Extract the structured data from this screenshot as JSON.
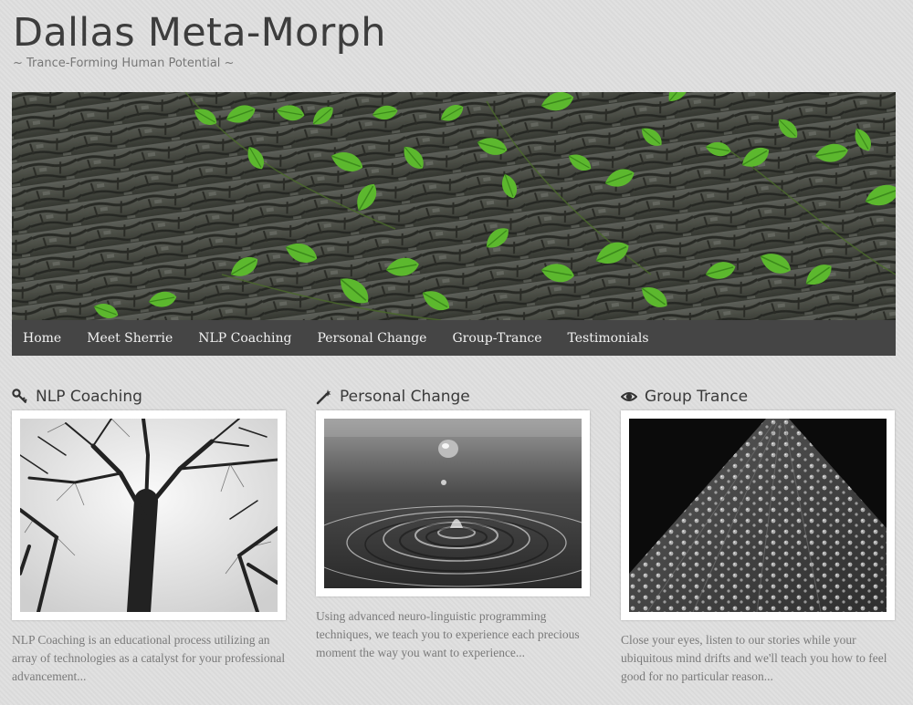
{
  "site": {
    "title": "Dallas Meta-Morph",
    "tagline": "~ Trance-Forming Human Potential ~"
  },
  "banner": {
    "image": "bark-with-green-ivy-leaves"
  },
  "nav": {
    "items": [
      {
        "label": "Home"
      },
      {
        "label": "Meet Sherrie"
      },
      {
        "label": "NLP Coaching"
      },
      {
        "label": "Personal Change"
      },
      {
        "label": "Group-Trance"
      },
      {
        "label": "Testimonials"
      }
    ]
  },
  "features": [
    {
      "icon": "key-icon",
      "title": "NLP Coaching",
      "image": "bare-trees-looking-up",
      "excerpt": "NLP Coaching is an educational process utilizing an array of technologies as a catalyst for your professional advancement..."
    },
    {
      "icon": "magic-wand-icon",
      "title": "Personal Change",
      "image": "water-droplet-ripples",
      "excerpt": "Using advanced neuro-linguistic programming techniques, we teach you to experience each precious moment the way you want to experience..."
    },
    {
      "icon": "eye-icon",
      "title": "Group Trance",
      "image": "water-drops-on-leaf",
      "excerpt": "Close your eyes, listen to our stories while your ubiquitous mind drifts and we'll teach you how to feel good for no particular reason..."
    }
  ],
  "colors": {
    "background": "#dedede",
    "nav_bg": "#454545",
    "nav_text": "#f2f2f2",
    "title_text": "#3d3d3d",
    "leaf_green": "#5cb82e"
  }
}
